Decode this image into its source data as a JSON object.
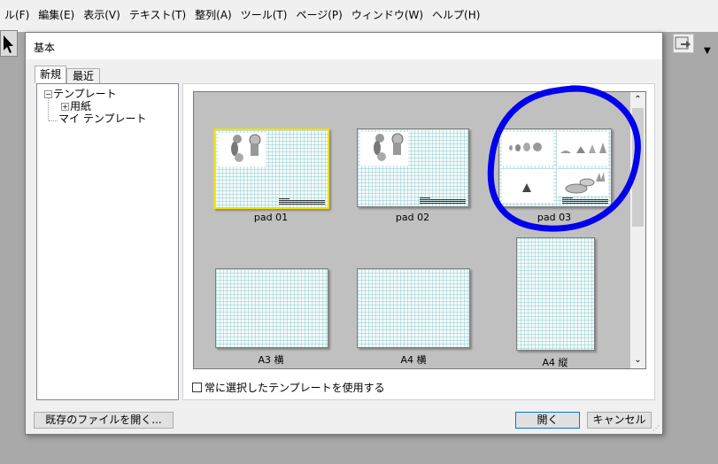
{
  "menu": {
    "items": [
      "ル(F)",
      "編集(E)",
      "表示(V)",
      "テキスト(T)",
      "整列(A)",
      "ツール(T)",
      "ページ(P)",
      "ウィンドウ(W)",
      "ヘルプ(H)"
    ]
  },
  "dialog": {
    "title": "基本",
    "tabs": {
      "new": "新規",
      "recent": "最近"
    },
    "tree": {
      "templates": "テンプレート",
      "paper": "用紙",
      "my_templates": "マイ テンプレート"
    },
    "thumbnails": [
      {
        "label": "pad 01"
      },
      {
        "label": "pad 02"
      },
      {
        "label": "pad 03"
      },
      {
        "label": "A3 横"
      },
      {
        "label": "A4 横"
      },
      {
        "label": "A4 縦"
      }
    ],
    "always_use_label": "常に選択したテンプレートを使用する",
    "open_existing_label": "既存のファイルを開く...",
    "open_label": "開く",
    "cancel_label": "キャンセル"
  },
  "icons": {
    "expander_collapse": "⊟",
    "expander_expand": "⊞",
    "scroll_up": "⌃",
    "scroll_down": "⌄",
    "dropdown": "▼"
  },
  "colors": {
    "selection_border": "#f0e000",
    "annotation_circle": "#0000ee",
    "default_button_border": "#0078d7"
  }
}
